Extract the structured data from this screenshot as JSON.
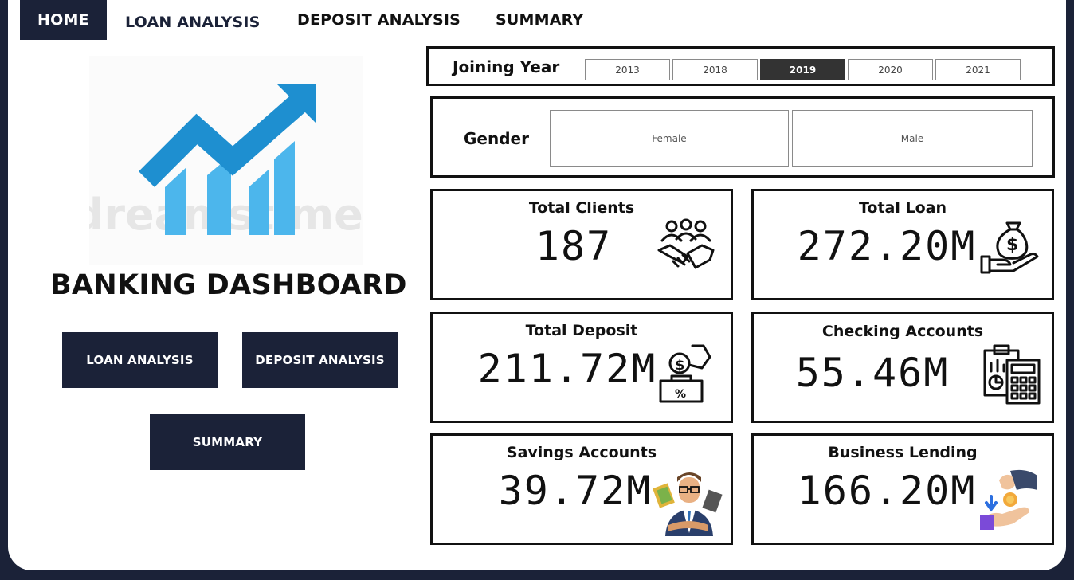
{
  "nav": {
    "home": "HOME",
    "loan_analysis": "LOAN ANALYSIS",
    "deposit_analysis": "DEPOSIT ANALYSIS",
    "summary": "SUMMARY"
  },
  "logo": {
    "watermark": "dreamstime.",
    "icon": "growth-chart-logo"
  },
  "dashboard_title": "BANKING DASHBOARD",
  "buttons": {
    "loan_analysis": "LOAN ANALYSIS",
    "deposit_analysis": "DEPOSIT ANALYSIS",
    "summary": "SUMMARY"
  },
  "filters": {
    "year_label": "Joining Year",
    "years": [
      "2013",
      "2018",
      "2019",
      "2020",
      "2021"
    ],
    "selected_year": "2019",
    "gender_label": "Gender",
    "genders": [
      "Female",
      "Male"
    ]
  },
  "cards": {
    "total_clients": {
      "title": "Total Clients",
      "value": "187",
      "icon": "handshake-group-icon"
    },
    "total_loan": {
      "title": "Total Loan",
      "value": "272.20M",
      "icon": "money-bag-hand-icon"
    },
    "total_deposit": {
      "title": "Total Deposit",
      "value": "211.72M",
      "icon": "deposit-box-icon"
    },
    "checking_accounts": {
      "title": "Checking Accounts",
      "value": "55.46M",
      "icon": "clipboard-calculator-icon"
    },
    "savings_accounts": {
      "title": "Savings Accounts",
      "value": "39.72M",
      "icon": "businessman-icon"
    },
    "business_lending": {
      "title": "Business Lending",
      "value": "166.20M",
      "icon": "coin-hands-icon"
    }
  },
  "colors": {
    "navy": "#1b2238",
    "chart_blue": "#1e8fd0",
    "chart_light_blue": "#4cb6ec",
    "selected_year": "#333333"
  }
}
